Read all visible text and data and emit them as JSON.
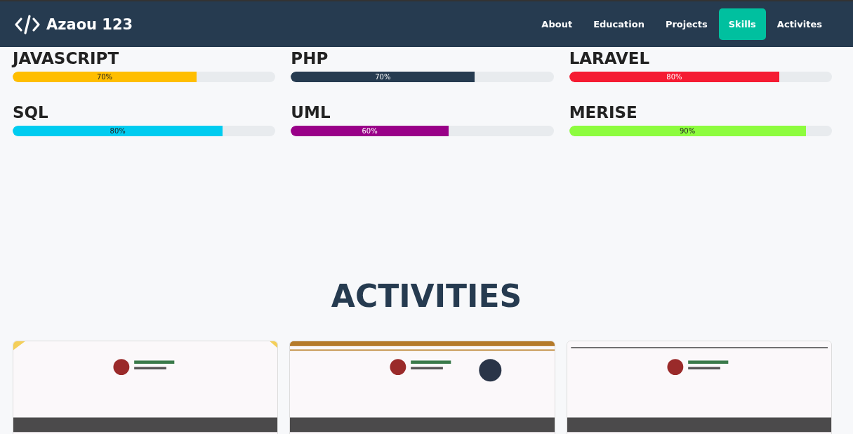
{
  "navbar": {
    "brand": "Azaou 123",
    "links": [
      {
        "label": "About",
        "selected": false
      },
      {
        "label": "Education",
        "selected": false
      },
      {
        "label": "Projects",
        "selected": false
      },
      {
        "label": "Skills",
        "selected": true
      },
      {
        "label": "Activites",
        "selected": false
      }
    ]
  },
  "skills": [
    {
      "name": "JAVASCRIPT",
      "level": 0.7,
      "reading": "70%",
      "color": "#ffbe00"
    },
    {
      "name": "PHP",
      "level": 0.7,
      "reading": "70%",
      "color": "#263b50"
    },
    {
      "name": "LARAVEL",
      "level": 0.8,
      "reading": "80%",
      "color": "#f51b32"
    },
    {
      "name": "SQL",
      "level": 0.8,
      "reading": "80%",
      "color": "#00ccf0"
    },
    {
      "name": "UML",
      "level": 0.6,
      "reading": "60%",
      "color": "#990088"
    },
    {
      "name": "MERISE",
      "level": 0.9,
      "reading": "90%",
      "color": "#8dfc3e"
    }
  ],
  "activities": {
    "title": "ACTIVITIES"
  }
}
